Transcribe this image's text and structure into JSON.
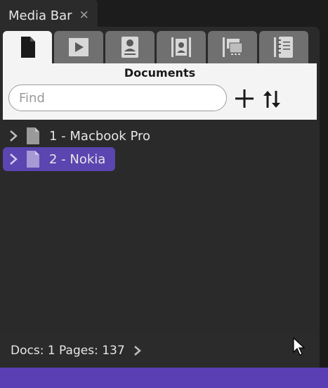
{
  "window": {
    "tab_title": "Media Bar",
    "close_glyph": "✕"
  },
  "tabs": [
    {
      "icon": "document-icon",
      "active": true
    },
    {
      "icon": "play-icon",
      "active": false
    },
    {
      "icon": "contact-card-icon",
      "active": false
    },
    {
      "icon": "storyboard-icon",
      "active": false
    },
    {
      "icon": "slides-icon",
      "active": false
    },
    {
      "icon": "notebook-icon",
      "active": false
    }
  ],
  "documents": {
    "title": "Documents",
    "search_placeholder": "Find",
    "search_value": "",
    "items": [
      {
        "label": "1 - Macbook Pro",
        "selected": false
      },
      {
        "label": "2 - Nokia",
        "selected": true
      }
    ]
  },
  "footer": {
    "stats": "Docs: 1 Pages: 137"
  },
  "colors": {
    "accent": "#5b45b0",
    "bottom_bar": "#5a3fb4",
    "panel_bg": "#1f1f1f"
  }
}
